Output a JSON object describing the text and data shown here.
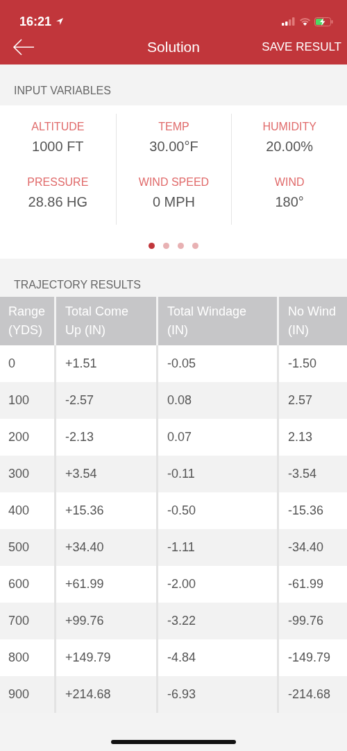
{
  "status_bar": {
    "time": "16:21"
  },
  "header": {
    "title": "Solution",
    "action": "SAVE RESULT"
  },
  "input_variables": {
    "title": "INPUT VARIABLES",
    "items": [
      {
        "label": "ALTITUDE",
        "value": "1000 FT"
      },
      {
        "label": "TEMP",
        "value": "30.00°F"
      },
      {
        "label": "HUMIDITY",
        "value": "20.00%"
      },
      {
        "label": "PRESSURE",
        "value": "28.86 HG"
      },
      {
        "label": "WIND SPEED",
        "value": "0 MPH"
      },
      {
        "label": "WIND",
        "value": "180°"
      }
    ],
    "pages": [
      {
        "selected": true
      },
      {
        "selected": false
      },
      {
        "selected": false
      },
      {
        "selected": false
      }
    ]
  },
  "trajectory": {
    "title": "TRAJECTORY RESULTS",
    "columns": [
      "Range (YDS)",
      "Total Come Up (IN)",
      "Total Windage (IN)",
      "No Wind (IN)"
    ],
    "rows": [
      [
        "0",
        "+1.51",
        "-0.05",
        "-1.50"
      ],
      [
        "100",
        "-2.57",
        "0.08",
        "2.57"
      ],
      [
        "200",
        "-2.13",
        "0.07",
        "2.13"
      ],
      [
        "300",
        "+3.54",
        "-0.11",
        "-3.54"
      ],
      [
        "400",
        "+15.36",
        "-0.50",
        "-15.36"
      ],
      [
        "500",
        "+34.40",
        "-1.11",
        "-34.40"
      ],
      [
        "600",
        "+61.99",
        "-2.00",
        "-61.99"
      ],
      [
        "700",
        "+99.76",
        "-3.22",
        "-99.76"
      ],
      [
        "800",
        "+149.79",
        "-4.84",
        "-149.79"
      ],
      [
        "900",
        "+214.68",
        "-6.93",
        "-214.68"
      ]
    ]
  }
}
